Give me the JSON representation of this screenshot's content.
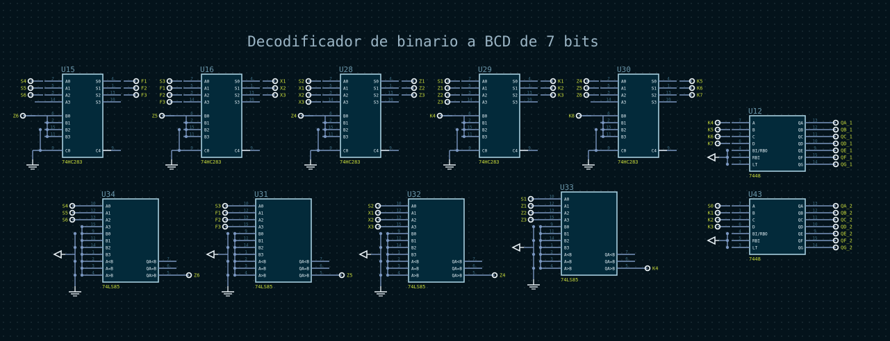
{
  "title": "Decodificador de binario a BCD de 7 bits",
  "colors": {
    "background": "#04131b",
    "body_fill": "#032a3a",
    "body_stroke": "#a8cfe0",
    "wire": "#7a96c0",
    "pin_number": "#3c6a80",
    "label": "#c7d93a",
    "refdes": "#6a96aa",
    "pin_name": "#e2eef4",
    "power": "#e6eef2"
  },
  "adders": [
    {
      "ref": "U15",
      "part": "74HC283",
      "inputs": [
        "S4",
        "S5",
        "S6",
        ""
      ],
      "carry_in": "Z6",
      "outputs": [
        "F1",
        "F2",
        "F3"
      ]
    },
    {
      "ref": "U16",
      "part": "74HC283",
      "inputs": [
        "S3",
        "F1",
        "F2",
        "F3"
      ],
      "carry_in": "Z5",
      "outputs": [
        "X1",
        "X2",
        "X3"
      ]
    },
    {
      "ref": "U28",
      "part": "74HC283",
      "inputs": [
        "S2",
        "X1",
        "X2",
        "X3"
      ],
      "carry_in": "Z4",
      "outputs": [
        "Z1",
        "Z2",
        "Z3"
      ]
    },
    {
      "ref": "U29",
      "part": "74HC283",
      "inputs": [
        "S1",
        "Z1",
        "Z2",
        "Z3"
      ],
      "carry_in": "K4",
      "outputs": [
        "K1",
        "K2",
        "K3"
      ]
    },
    {
      "ref": "U30",
      "part": "74HC283",
      "inputs": [
        "Z4",
        "Z5",
        "Z6",
        ""
      ],
      "carry_in": "K8",
      "outputs": [
        "K5",
        "K6",
        "K7"
      ]
    }
  ],
  "comparators": [
    {
      "ref": "U34",
      "part": "74LS85",
      "inputs": [
        "S4",
        "S5",
        "S6"
      ],
      "output": "Z6"
    },
    {
      "ref": "U31",
      "part": "74LS85",
      "inputs": [
        "S3",
        "F1",
        "F2",
        "F3"
      ],
      "output": "Z5"
    },
    {
      "ref": "U32",
      "part": "74LS85",
      "inputs": [
        "S2",
        "X1",
        "X2",
        "X3"
      ],
      "output": "Z4"
    },
    {
      "ref": "U33",
      "part": "74LS85",
      "inputs": [
        "S1",
        "Z1",
        "Z2",
        "Z3"
      ],
      "output": "K4"
    }
  ],
  "decoders": [
    {
      "ref": "U12",
      "part": "7448",
      "inputs": [
        "K4",
        "K5",
        "K6",
        "K7"
      ],
      "outputs": [
        "QA_1",
        "QB_1",
        "QC_1",
        "QD_1",
        "QE_1",
        "QF_1",
        "QG_1"
      ]
    },
    {
      "ref": "U43",
      "part": "7448",
      "inputs": [
        "S0",
        "K1",
        "K2",
        "K3"
      ],
      "outputs": [
        "QA_2",
        "QB_2",
        "QC_2",
        "QD_2",
        "QE_2",
        "QF_2",
        "QG_2"
      ]
    }
  ],
  "pin_names": {
    "adder_left": [
      "A0",
      "A1",
      "A2",
      "A3",
      "B0",
      "B1",
      "B2",
      "B3",
      "C0"
    ],
    "adder_right": [
      "S0",
      "S1",
      "S2",
      "S3",
      "C4"
    ],
    "adder_left_nums": [
      "7",
      "5",
      "3",
      "14",
      "6",
      "2",
      "15",
      "11",
      "9"
    ],
    "adder_right_nums": [
      "4",
      "1",
      "13",
      "10",
      "9"
    ],
    "comp_left": [
      "A0",
      "A1",
      "A2",
      "A3",
      "B0",
      "B1",
      "B2",
      "B3",
      "A<B",
      "A=B",
      "A>B"
    ],
    "comp_right": [
      "QA<B",
      "QA=B",
      "QA>B"
    ],
    "comp_left_nums": [
      "10",
      "12",
      "13",
      "15",
      "9",
      "11",
      "14",
      "1",
      "2",
      "3",
      "4"
    ],
    "comp_right_nums": [
      "7",
      "6",
      "5"
    ],
    "dec_left": [
      "A",
      "B",
      "C",
      "D",
      "BI/RBO",
      "RBI",
      "LT"
    ],
    "dec_right": [
      "QA",
      "QB",
      "QC",
      "QD",
      "QE",
      "QF",
      "QG"
    ],
    "dec_left_nums": [
      "7",
      "1",
      "2",
      "6",
      "4",
      "5",
      "3"
    ],
    "dec_right_nums": [
      "13",
      "12",
      "11",
      "10",
      "9",
      "15",
      "14"
    ]
  }
}
